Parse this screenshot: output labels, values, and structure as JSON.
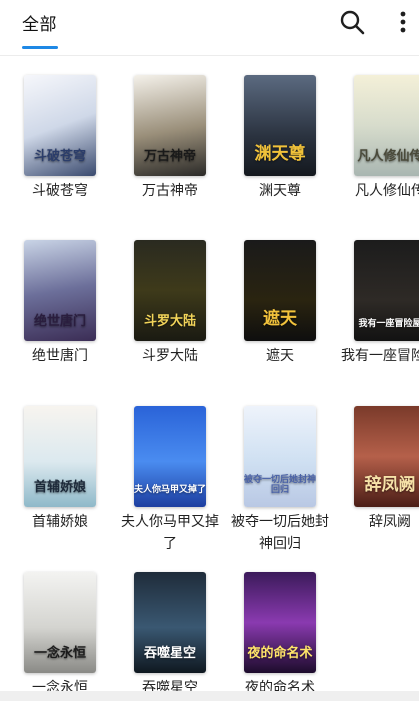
{
  "header": {
    "tab_label": "全部",
    "search_icon": "search-icon",
    "more_icon": "more-vert-icon",
    "accent": "#1e88e5"
  },
  "books": [
    {
      "title": "斗破苍穹",
      "cover_text": "斗破苍穹",
      "bg": "linear-gradient(160deg,#f6f7fb 0%,#cfd8e8 50%,#3a4a6e 100%)",
      "fg": "#2b3d6a"
    },
    {
      "title": "万古神帝",
      "cover_text": "万古神帝",
      "bg": "linear-gradient(170deg,#f4f1ea 0%,#9a8f7a 55%,#2b2a28 100%)",
      "fg": "#1a1a1a"
    },
    {
      "title": "渊天尊",
      "cover_text": "渊天尊",
      "bg": "linear-gradient(180deg,#5b6a80 0%,#2b3340 60%,#14181e 100%)",
      "fg": "#f1c23a"
    },
    {
      "title": "凡人修仙传",
      "cover_text": "凡人修仙传",
      "bg": "linear-gradient(180deg,#f4f0d8 0%,#d7dccc 50%,#a9b6b1 100%)",
      "fg": "#4a4a3a"
    },
    {
      "title": "绝世唐门",
      "cover_text": "绝世唐门",
      "bg": "linear-gradient(170deg,#c9d4e6 0%,#6c6f9a 50%,#3b2d55 100%)",
      "fg": "#2a1d3e"
    },
    {
      "title": "斗罗大陆",
      "cover_text": "斗罗大陆",
      "bg": "linear-gradient(180deg,#2a2a20 0%,#3e3a1a 50%,#1a1a12 100%)",
      "fg": "#f3d55a"
    },
    {
      "title": "遮天",
      "cover_text": "遮天",
      "bg": "linear-gradient(180deg,#1a1a1a 0%,#2a2410 60%,#0e0e0e 100%)",
      "fg": "#f2c23c"
    },
    {
      "title": "我有一座冒险屋",
      "cover_text": "我有一座冒险屋",
      "bg": "linear-gradient(180deg,#1c1c1c 0%,#2e2a26 60%,#121212 100%)",
      "fg": "#ffffff"
    },
    {
      "title": "首辅娇娘",
      "cover_text": "首辅娇娘",
      "bg": "linear-gradient(180deg,#f7f4ef 0%,#dce9ef 55%,#8fb9c9 100%)",
      "fg": "#1d2a3a"
    },
    {
      "title": "夫人你马甲又掉了",
      "cover_text": "夫人你马甲又掉了",
      "bg": "linear-gradient(180deg,#2a63d8 0%,#4a8cf0 55%,#1d3ea0 100%)",
      "fg": "#ffffff"
    },
    {
      "title": "被夺一切后她封神回归",
      "cover_text": "被夺一切后她封神回归",
      "bg": "linear-gradient(180deg,#eef3fb 0%,#cfe0f2 55%,#b9c8e4 100%)",
      "fg": "#4a62a8"
    },
    {
      "title": "辞凤阙",
      "cover_text": "辞凤阙",
      "bg": "linear-gradient(180deg,#7a3a2a 0%,#b5604a 50%,#4a1d16 100%)",
      "fg": "#f6e2a8"
    },
    {
      "title": "一念永恒",
      "cover_text": "一念永恒",
      "bg": "linear-gradient(180deg,#f3f3f1 0%,#d4d4d0 55%,#8a8a86 100%)",
      "fg": "#1a1a1a"
    },
    {
      "title": "吞噬星空",
      "cover_text": "吞噬星空",
      "bg": "linear-gradient(180deg,#1f2c3a 0%,#3a5872 55%,#0f1820 100%)",
      "fg": "#ffffff"
    },
    {
      "title": "夜的命名术",
      "cover_text": "夜的命名术",
      "bg": "linear-gradient(180deg,#3b1a5a 0%,#8a3ab0 50%,#1d0c2c 100%)",
      "fg": "#ffe46a"
    }
  ]
}
